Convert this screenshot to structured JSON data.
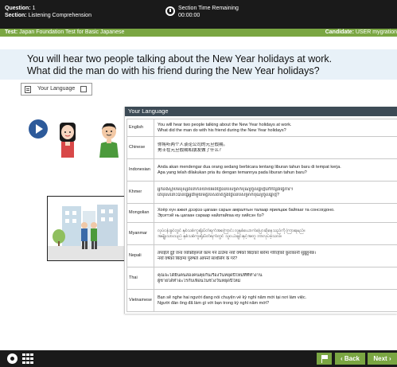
{
  "header": {
    "question_label": "Question:",
    "question_value": "1",
    "section_label": "Section:",
    "section_value": "Listening Comprehension",
    "timer_label": "Section Time Remaining",
    "timer_value": "00:00:00"
  },
  "testbar": {
    "test_label": "Test:",
    "test_value": "Japan Foundation Test for Basic Japanese",
    "candidate_label": "Candidate:",
    "candidate_value": "USER mygration"
  },
  "question": {
    "line1": "You will hear two people talking about the New Year holidays at work.",
    "line2": "What did the man do with his friend during the New Year holidays?"
  },
  "language_button": {
    "label": "Your Language"
  },
  "language_panel": {
    "title": "Your Language",
    "rows": [
      {
        "language": "English",
        "lines": [
          "You will hear two people talking about the New Year holidays at work.",
          "What did the man do with his friend during the New Year holidays?"
        ]
      },
      {
        "language": "Chinese",
        "lines": [
          "你将听两个人谈论公司的元旦假期。",
          "男士在元旦假期和朋友做了什么？"
        ]
      },
      {
        "language": "Indonesian",
        "lines": [
          "Anda akan mendengar dua orang sedang berbicara tentang liburan tahun baru di tempat kerja.",
          "Apa yang telah dilakukan pria itu dengan temannya pada liburan tahun baru?"
        ]
      },
      {
        "language": "Khmer",
        "lines": [
          "អ្នកនឹងស្តាប់មនុស្សពីរនាក់និយាយអំពីថ្ងៃឈប់សម្រាកបុណ្យចូលឆ្នាំថ្មីនៅកន្លែងធ្វើការ។",
          "តើបុរសនោះបានធ្វើអ្វីជាមួយមិត្តរបស់គាត់ក្នុងថ្ងៃឈប់សម្រាកបុណ្យចូលឆ្នាំថ្មី?"
        ]
      },
      {
        "language": "Mongolian",
        "lines": [
          "Хоёр хүн ажил дээрээ цагаан сарын амралтын талаар ярилцаж байгааг та сонсогдоно.",
          "Эрэгтэй нь цагаан сараар найзтайгаа юу хийсэн бэ?"
        ]
      },
      {
        "language": "Myanmar",
        "lines": [
          "လုပ်ငန်းခွင်တွင် နှစ်သစ်ကူးရုံးပိတ်ရက်အကြောင်း လူနှစ်ယောက်ပြောဆိုနေသည်ကို ကြားရမည်။",
          "အမျိုးသားသည် နှစ်သစ်ကူးရုံးပိတ်ရက်တွင် သူငယ်ချင်းနှင့်အတူ ဘာလုပ်ခဲ့သလဲ။"
        ]
      },
      {
        "language": "Nepali",
        "lines": [
          "तपाईले दुई जना व्यक्तिहरूले काम गर्ने ठाउँमा नयाँ वर्षको बिदाको बारेमा गरिरहेको कुराकानी सुन्नुहुनेछ।",
          "नयाँ वर्षको बिदामा पुरुषले आफ्नो साथीसँग के गरे?"
        ]
      },
      {
        "language": "Thai",
        "lines": [
          "คุณจะได้ยินคนสองคนคุยกันเรื่องวันหยุดปีใหม่ที่ที่ทำงาน",
          "ผู้ชายได้ทำอะไรกับเพื่อนในช่วงวันหยุดปีใหม่"
        ]
      },
      {
        "language": "Vietnamese",
        "lines": [
          "Bạn sẽ nghe hai người đang nói chuyện về kỳ nghỉ năm mới tại nơi làm việc.",
          "Người đàn ông đã làm gì với bạn trong kỳ nghỉ năm mới?"
        ]
      }
    ]
  },
  "footer": {
    "back_label": "Back",
    "next_label": "Next"
  },
  "icons": {
    "timer": "clock-icon",
    "language": "document-icon",
    "external": "external-link-icon",
    "play": "play-icon",
    "settings": "gear-icon",
    "grid": "grid-icon",
    "flag": "flag-icon"
  },
  "colors": {
    "accent": "#7aa642",
    "header_bg": "#1a1a1a",
    "question_bg": "#e8f1f8",
    "play": "#2d5a9a",
    "panel_header": "#3d4b56"
  }
}
